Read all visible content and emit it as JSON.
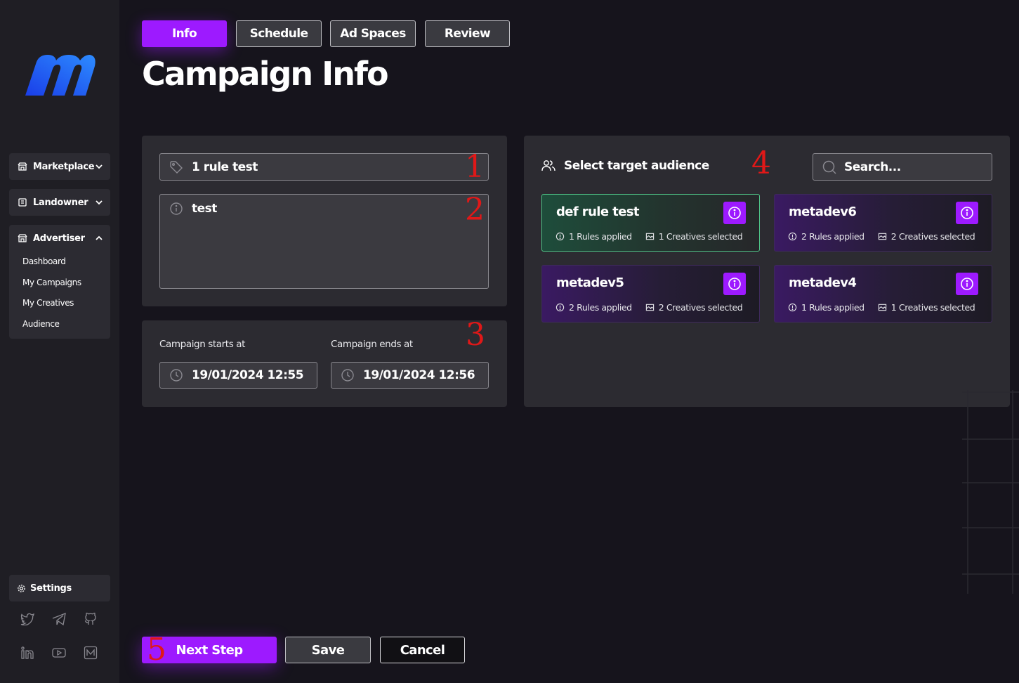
{
  "sidebar": {
    "logo": "m-logo",
    "groups": [
      {
        "label": "Marketplace",
        "icon": "store-icon",
        "expanded": false
      },
      {
        "label": "Landowner",
        "icon": "building-icon",
        "expanded": false
      },
      {
        "label": "Advertiser",
        "icon": "store-icon",
        "expanded": true,
        "items": [
          "Dashboard",
          "My Campaigns",
          "My Creatives",
          "Audience"
        ]
      }
    ],
    "settings_label": "Settings",
    "social": [
      "twitter-icon",
      "telegram-icon",
      "github-icon",
      "linkedin-icon",
      "youtube-icon",
      "medium-icon"
    ]
  },
  "tabs": [
    {
      "label": "Info",
      "active": true
    },
    {
      "label": "Schedule",
      "active": false
    },
    {
      "label": "Ad Spaces",
      "active": false
    },
    {
      "label": "Review",
      "active": false
    }
  ],
  "page_title": "Campaign Info",
  "form": {
    "name_value": "1 rule test",
    "description_value": "test",
    "start_label": "Campaign starts at",
    "start_value": "19/01/2024 12:55",
    "end_label": "Campaign ends at",
    "end_value": "19/01/2024 12:56"
  },
  "audience": {
    "title": "Select target audience",
    "search_placeholder": "Search...",
    "cards": [
      {
        "name": "def rule test",
        "rules": "1 Rules applied",
        "creatives": "1 Creatives selected",
        "selected": true
      },
      {
        "name": "metadev6",
        "rules": "2 Rules applied",
        "creatives": "2 Creatives selected",
        "selected": false
      },
      {
        "name": "metadev5",
        "rules": "2 Rules applied",
        "creatives": "2 Creatives selected",
        "selected": false
      },
      {
        "name": "metadev4",
        "rules": "1 Rules applied",
        "creatives": "1 Creatives selected",
        "selected": false
      }
    ]
  },
  "markers": [
    "1",
    "2",
    "3",
    "4",
    "5"
  ],
  "buttons": {
    "next": "Next Step",
    "save": "Save",
    "cancel": "Cancel"
  },
  "colors": {
    "accent": "#9d1aff",
    "background": "#16141c",
    "panel": "#2c2b31",
    "selected_border": "#4fc487",
    "marker": "#e01818"
  }
}
